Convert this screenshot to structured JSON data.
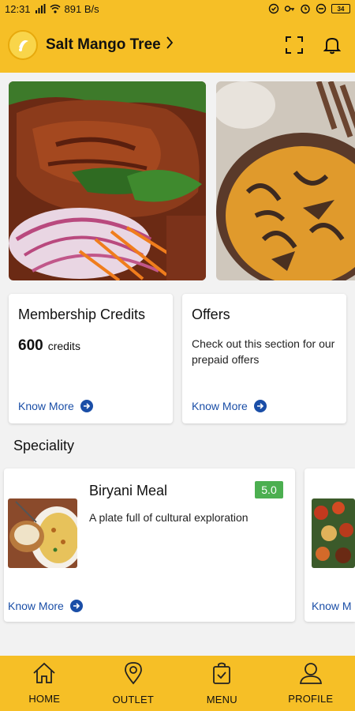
{
  "status_bar": {
    "time": "12:31",
    "net_speed": "891 B/s",
    "battery": "34"
  },
  "header": {
    "title": "Salt Mango Tree"
  },
  "cards": {
    "membership": {
      "title": "Membership Credits",
      "credits_value": "600",
      "credits_label": "credits",
      "link": "Know More"
    },
    "offers": {
      "title": "Offers",
      "description": "Check out this section for our prepaid offers",
      "link": "Know More"
    }
  },
  "speciality": {
    "section_title": "Speciality",
    "items": [
      {
        "title": "Biryani Meal",
        "description": "A plate full of cultural exploration",
        "rating": "5.0",
        "link": "Know More"
      },
      {
        "link": "Know M"
      }
    ]
  },
  "nav": {
    "items": [
      {
        "label": "HOME",
        "icon": "home-icon"
      },
      {
        "label": "OUTLET",
        "icon": "location-pin-icon"
      },
      {
        "label": "MENU",
        "icon": "shopping-bag-icon"
      },
      {
        "label": "PROFILE",
        "icon": "profile-icon"
      }
    ]
  },
  "colors": {
    "brand_yellow": "#f6bf26",
    "link_blue": "#1a4ea7",
    "rating_green": "#4caf50"
  }
}
